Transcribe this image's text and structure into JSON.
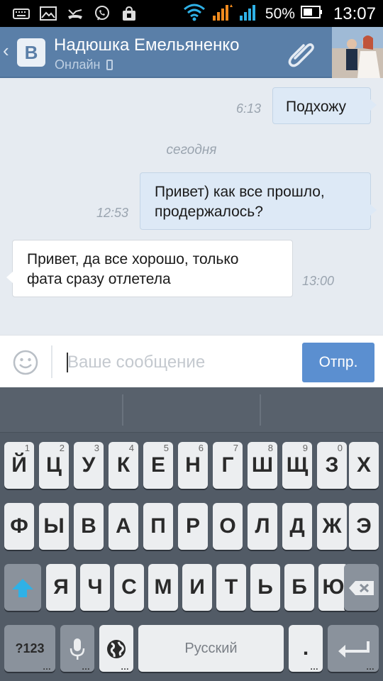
{
  "status_bar": {
    "battery_percent": "50%",
    "time": "13:07",
    "left_icons": [
      "keyboard-icon",
      "gallery-icon",
      "missed-call-icon",
      "viber-icon",
      "store-icon"
    ],
    "right_icons": [
      "wifi-icon",
      "signal-orange-icon",
      "signal-blue-icon",
      "battery-icon"
    ]
  },
  "header": {
    "contact_name": "Надюшка Емельяненко",
    "status": "Онлайн",
    "status_icon": "mobile-phone-icon",
    "attach_icon": "paperclip-icon",
    "brand_letter": "В",
    "colors": {
      "header_bg": "#5a7fa8",
      "status_text": "#bfd0e3"
    }
  },
  "messages": [
    {
      "direction": "out",
      "text": "Подхожу",
      "time": "6:13"
    },
    {
      "type": "day_separator",
      "text": "сегодня"
    },
    {
      "direction": "out",
      "text": "Привет) как все прошло, продержалось?",
      "lines": [
        "Привет) как все прошло,",
        "продержалось?"
      ],
      "time": "12:53"
    },
    {
      "direction": "in",
      "text": "Привет, да все хорошо, только фата сразу отлетела",
      "lines": [
        "Привет, да все хорошо, только",
        "фата сразу отлетела"
      ],
      "time": "13:00"
    }
  ],
  "composer": {
    "placeholder": "Ваше сообщение",
    "send_label": "Отпр.",
    "emoji_icon": "smiley-icon",
    "colors": {
      "send_bg": "#5b8fd0"
    }
  },
  "keyboard": {
    "row1": [
      {
        "label": "Й",
        "hint": "1"
      },
      {
        "label": "Ц",
        "hint": "2"
      },
      {
        "label": "У",
        "hint": "3"
      },
      {
        "label": "К",
        "hint": "4"
      },
      {
        "label": "Е",
        "hint": "5"
      },
      {
        "label": "Н",
        "hint": "6"
      },
      {
        "label": "Г",
        "hint": "7"
      },
      {
        "label": "Ш",
        "hint": "8"
      },
      {
        "label": "Щ",
        "hint": "9"
      },
      {
        "label": "З",
        "hint": "0"
      },
      {
        "label": "Х",
        "hint": ""
      }
    ],
    "row2": [
      "Ф",
      "Ы",
      "В",
      "А",
      "П",
      "Р",
      "О",
      "Л",
      "Д",
      "Ж",
      "Э"
    ],
    "row3": [
      "Я",
      "Ч",
      "С",
      "М",
      "И",
      "Т",
      "Ь",
      "Б",
      "Ю"
    ],
    "symbols_label": "?123",
    "space_label": "Русский",
    "period_label": ".",
    "icons": {
      "shift": "shift-arrow-icon",
      "backspace": "backspace-icon",
      "mic": "microphone-icon",
      "globe": "globe-icon",
      "enter": "enter-arrow-icon"
    }
  }
}
